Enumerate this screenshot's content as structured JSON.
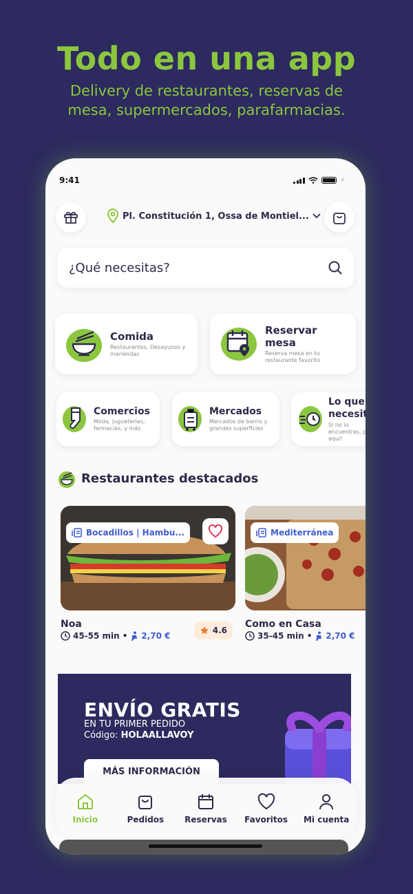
{
  "hero": {
    "title": "Todo en una app",
    "subtitle_line1": "Delivery de restaurantes, reservas de",
    "subtitle_line2": "mesa, supermercados, parafarmacias."
  },
  "status_bar": {
    "time": "9:41"
  },
  "header": {
    "address": "Pl. Constitución 1, Ossa de Montiel..."
  },
  "search": {
    "placeholder": "¿Qué necesitas?"
  },
  "categories": [
    {
      "title": "Comida",
      "description": "Restaurantes, Desayunos y meriendas"
    },
    {
      "title": "Reservar mesa",
      "description": "Reserva mesa en tu restaurante favorito"
    },
    {
      "title": "Comercios",
      "description": "Moda, jugueterías, farmacias, y más"
    },
    {
      "title": "Mercados",
      "description": "Mercados de barrio y grandes superficies"
    },
    {
      "title": "Lo que necesites",
      "description": "Si no lo encuentras, por aquí!"
    }
  ],
  "featured": {
    "title": "Restaurantes destacados",
    "restaurants": [
      {
        "tag": "Bocadillos | Hambu...",
        "name": "Noa",
        "time": "45-55 min",
        "fee": "2,70 €",
        "rating": "4.6"
      },
      {
        "tag": "Mediterránea",
        "name": "Como en Casa",
        "time": "35-45 min",
        "fee": "2,70 €"
      }
    ]
  },
  "promo": {
    "heading": "ENVÍO GRATIS",
    "line1": "EN TU PRIMER PEDIDO",
    "code_label": "Código: ",
    "code": "HOLAALLAVOY",
    "button": "MÁS INFORMACIÓN"
  },
  "nav": [
    {
      "label": "Inicio",
      "active": true
    },
    {
      "label": "Pedidos"
    },
    {
      "label": "Reservas"
    },
    {
      "label": "Favoritos"
    },
    {
      "label": "Mi cuenta"
    }
  ],
  "colors": {
    "accent": "#8cc63f",
    "background": "#2c2a5e",
    "link": "#3f5ecf"
  }
}
